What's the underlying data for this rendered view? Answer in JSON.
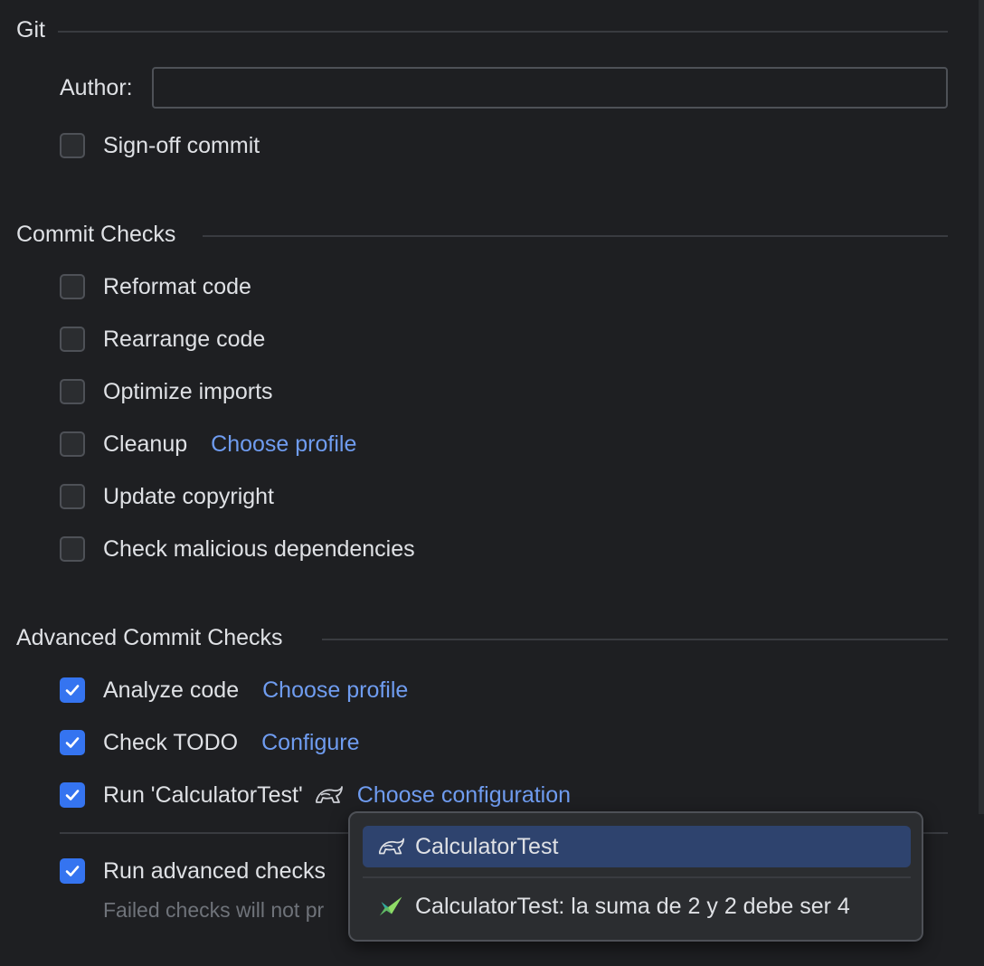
{
  "git": {
    "title": "Git",
    "author_label": "Author:",
    "author_value": "",
    "sign_off": {
      "label": "Sign-off commit",
      "checked": false
    }
  },
  "commit_checks": {
    "title": "Commit Checks",
    "items": [
      {
        "label": "Reformat code",
        "checked": false
      },
      {
        "label": "Rearrange code",
        "checked": false
      },
      {
        "label": "Optimize imports",
        "checked": false
      },
      {
        "label": "Cleanup",
        "checked": false,
        "link": "Choose profile"
      },
      {
        "label": "Update copyright",
        "checked": false
      },
      {
        "label": "Check malicious dependencies",
        "checked": false
      }
    ]
  },
  "advanced_checks": {
    "title": "Advanced Commit Checks",
    "items": [
      {
        "label": "Analyze code",
        "checked": true,
        "link": "Choose profile"
      },
      {
        "label": "Check TODO",
        "checked": true,
        "link": "Configure"
      },
      {
        "label": "Run 'CalculatorTest'",
        "checked": true,
        "icon": "test-config-icon",
        "link": "Choose configuration"
      }
    ],
    "run_after": {
      "label": "Run advanced checks",
      "checked": true
    },
    "hint": "Failed checks will not pr"
  },
  "config_popup": {
    "items": [
      {
        "label": "CalculatorTest",
        "icon": "test-config-icon",
        "selected": true
      },
      {
        "label": "CalculatorTest: la suma de 2 y 2 debe ser 4",
        "icon": "test-passed-icon",
        "selected": false
      }
    ]
  },
  "colors": {
    "background": "#1e1f22",
    "accent": "#3574f0",
    "link": "#6f9cf0",
    "selection": "#2e436e"
  }
}
